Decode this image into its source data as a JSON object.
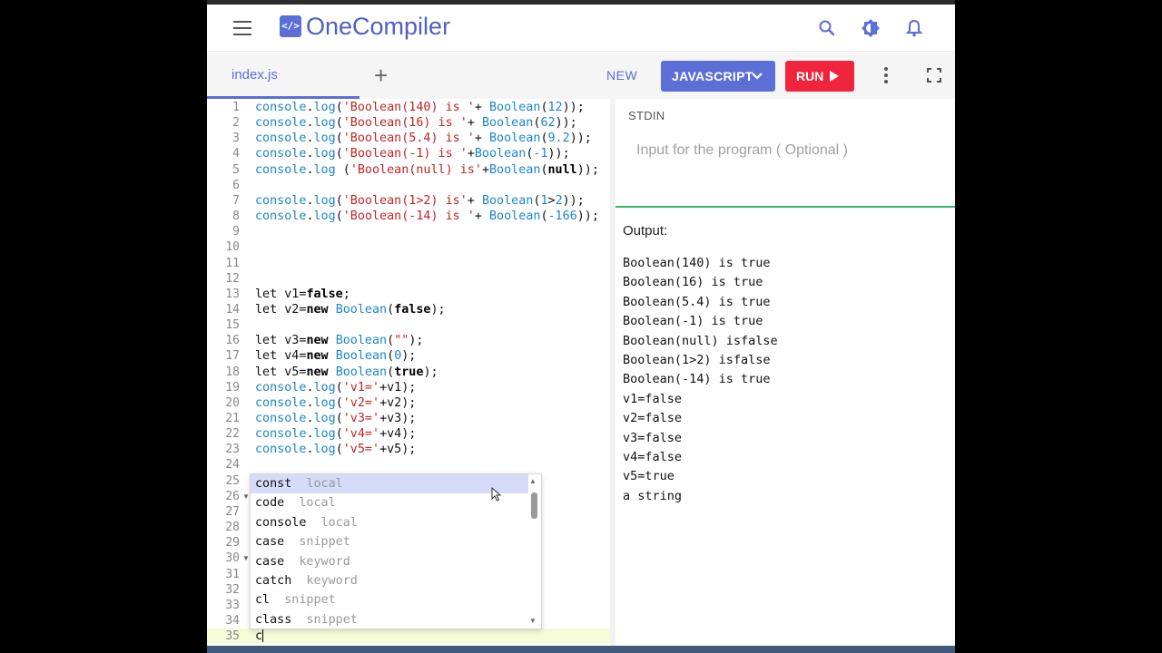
{
  "app": {
    "name": "OneCompiler",
    "logo_glyph": "</>",
    "accent_color": "#5b6fd6",
    "run_color": "#f0243c"
  },
  "header": {
    "icons": [
      "menu-icon",
      "search-icon",
      "theme-icon",
      "bell-icon"
    ]
  },
  "toolbar": {
    "file_tab": "index.js",
    "add_label": "+",
    "new_label": "NEW",
    "language_label": "JAVASCRIPT",
    "run_label": "RUN"
  },
  "editor": {
    "lines": [
      {
        "n": "1"
      },
      {
        "n": "2"
      },
      {
        "n": "3"
      },
      {
        "n": "4"
      },
      {
        "n": "5"
      },
      {
        "n": "6"
      },
      {
        "n": "7"
      },
      {
        "n": "8"
      },
      {
        "n": "9"
      },
      {
        "n": "10"
      },
      {
        "n": "11"
      },
      {
        "n": "12"
      },
      {
        "n": "13"
      },
      {
        "n": "14"
      },
      {
        "n": "15"
      },
      {
        "n": "16"
      },
      {
        "n": "17"
      },
      {
        "n": "18"
      },
      {
        "n": "19"
      },
      {
        "n": "20"
      },
      {
        "n": "21"
      },
      {
        "n": "22"
      },
      {
        "n": "23"
      },
      {
        "n": "24"
      },
      {
        "n": "25"
      },
      {
        "n": "26"
      },
      {
        "n": "27"
      },
      {
        "n": "28"
      },
      {
        "n": "29"
      },
      {
        "n": "30"
      },
      {
        "n": "31"
      },
      {
        "n": "32"
      },
      {
        "n": "33"
      },
      {
        "n": "34"
      },
      {
        "n": "35"
      }
    ],
    "code": [
      [
        [
          "f",
          "console"
        ],
        [
          "p",
          "."
        ],
        [
          "f",
          "log"
        ],
        [
          "p",
          "("
        ],
        [
          "s",
          "'Boolean(140) is '"
        ],
        [
          "p",
          "+ "
        ],
        [
          "b",
          "Boolean"
        ],
        [
          "p",
          "("
        ],
        [
          "n",
          "12"
        ],
        [
          "p",
          "));"
        ]
      ],
      [
        [
          "f",
          "console"
        ],
        [
          "p",
          "."
        ],
        [
          "f",
          "log"
        ],
        [
          "p",
          "("
        ],
        [
          "s",
          "'Boolean(16) is '"
        ],
        [
          "p",
          "+ "
        ],
        [
          "b",
          "Boolean"
        ],
        [
          "p",
          "("
        ],
        [
          "n",
          "62"
        ],
        [
          "p",
          "));"
        ]
      ],
      [
        [
          "f",
          "console"
        ],
        [
          "p",
          "."
        ],
        [
          "f",
          "log"
        ],
        [
          "p",
          "("
        ],
        [
          "s",
          "'Boolean(5.4) is '"
        ],
        [
          "p",
          "+ "
        ],
        [
          "b",
          "Boolean"
        ],
        [
          "p",
          "("
        ],
        [
          "n",
          "9.2"
        ],
        [
          "p",
          "));"
        ]
      ],
      [
        [
          "f",
          "console"
        ],
        [
          "p",
          "."
        ],
        [
          "f",
          "log"
        ],
        [
          "p",
          "("
        ],
        [
          "s",
          "'Boolean(-1) is '"
        ],
        [
          "p",
          "+"
        ],
        [
          "b",
          "Boolean"
        ],
        [
          "p",
          "("
        ],
        [
          "n",
          "-1"
        ],
        [
          "p",
          "));"
        ]
      ],
      [
        [
          "f",
          "console"
        ],
        [
          "p",
          "."
        ],
        [
          "f",
          "log"
        ],
        [
          "p",
          " ("
        ],
        [
          "s",
          "'Boolean(null) is'"
        ],
        [
          "p",
          "+"
        ],
        [
          "b",
          "Boolean"
        ],
        [
          "p",
          "("
        ],
        [
          "k",
          "null"
        ],
        [
          "p",
          "));"
        ]
      ],
      [],
      [
        [
          "f",
          "console"
        ],
        [
          "p",
          "."
        ],
        [
          "f",
          "log"
        ],
        [
          "p",
          "("
        ],
        [
          "s",
          "'Boolean(1>2) is'"
        ],
        [
          "p",
          "+ "
        ],
        [
          "b",
          "Boolean"
        ],
        [
          "p",
          "("
        ],
        [
          "n",
          "1"
        ],
        [
          "p",
          ">"
        ],
        [
          "n",
          "2"
        ],
        [
          "p",
          "));"
        ]
      ],
      [
        [
          "f",
          "console"
        ],
        [
          "p",
          "."
        ],
        [
          "f",
          "log"
        ],
        [
          "p",
          "("
        ],
        [
          "s",
          "'Boolean(-14) is '"
        ],
        [
          "p",
          "+ "
        ],
        [
          "b",
          "Boolean"
        ],
        [
          "p",
          "("
        ],
        [
          "n",
          "-166"
        ],
        [
          "p",
          "));"
        ]
      ],
      [],
      [],
      [],
      [],
      [
        [
          "p",
          "let v1="
        ],
        [
          "k",
          "false"
        ],
        [
          "p",
          ";"
        ]
      ],
      [
        [
          "p",
          "let v2="
        ],
        [
          "k",
          "new"
        ],
        [
          "p",
          " "
        ],
        [
          "b",
          "Boolean"
        ],
        [
          "p",
          "("
        ],
        [
          "k",
          "false"
        ],
        [
          "p",
          ");"
        ]
      ],
      [],
      [
        [
          "p",
          "let v3="
        ],
        [
          "k",
          "new"
        ],
        [
          "p",
          " "
        ],
        [
          "b",
          "Boolean"
        ],
        [
          "p",
          "("
        ],
        [
          "s",
          "\"\""
        ],
        [
          "p",
          ");"
        ]
      ],
      [
        [
          "p",
          "let v4="
        ],
        [
          "k",
          "new"
        ],
        [
          "p",
          " "
        ],
        [
          "b",
          "Boolean"
        ],
        [
          "p",
          "("
        ],
        [
          "n",
          "0"
        ],
        [
          "p",
          ");"
        ]
      ],
      [
        [
          "p",
          "let v5="
        ],
        [
          "k",
          "new"
        ],
        [
          "p",
          " "
        ],
        [
          "b",
          "Boolean"
        ],
        [
          "p",
          "("
        ],
        [
          "k",
          "true"
        ],
        [
          "p",
          ");"
        ]
      ],
      [
        [
          "f",
          "console"
        ],
        [
          "p",
          "."
        ],
        [
          "f",
          "log"
        ],
        [
          "p",
          "("
        ],
        [
          "s",
          "'v1='"
        ],
        [
          "p",
          "+v1);"
        ]
      ],
      [
        [
          "f",
          "console"
        ],
        [
          "p",
          "."
        ],
        [
          "f",
          "log"
        ],
        [
          "p",
          "("
        ],
        [
          "s",
          "'v2='"
        ],
        [
          "p",
          "+v2);"
        ]
      ],
      [
        [
          "f",
          "console"
        ],
        [
          "p",
          "."
        ],
        [
          "f",
          "log"
        ],
        [
          "p",
          "("
        ],
        [
          "s",
          "'v3='"
        ],
        [
          "p",
          "+v3);"
        ]
      ],
      [
        [
          "f",
          "console"
        ],
        [
          "p",
          "."
        ],
        [
          "f",
          "log"
        ],
        [
          "p",
          "("
        ],
        [
          "s",
          "'v4='"
        ],
        [
          "p",
          "+v4);"
        ]
      ],
      [
        [
          "f",
          "console"
        ],
        [
          "p",
          "."
        ],
        [
          "f",
          "log"
        ],
        [
          "p",
          "("
        ],
        [
          "s",
          "'v5='"
        ],
        [
          "p",
          "+v5);"
        ]
      ],
      [],
      [],
      [],
      [],
      [],
      [],
      [],
      [],
      [],
      [],
      [],
      [
        [
          "p",
          "c"
        ]
      ]
    ],
    "fold_lines": [
      "26",
      "30"
    ]
  },
  "autocomplete": {
    "items": [
      {
        "label": "const",
        "kind": "local"
      },
      {
        "label": "code",
        "kind": "local"
      },
      {
        "label": "console",
        "kind": "local"
      },
      {
        "label": "case",
        "kind": "snippet"
      },
      {
        "label": "case",
        "kind": "keyword"
      },
      {
        "label": "catch",
        "kind": "keyword"
      },
      {
        "label": "cl",
        "kind": "snippet"
      },
      {
        "label": "class",
        "kind": "snippet"
      }
    ]
  },
  "stdin": {
    "label": "STDIN",
    "placeholder": "Input for the program ( Optional )"
  },
  "output": {
    "label": "Output:",
    "lines": [
      "Boolean(140) is true",
      "Boolean(16) is true",
      "Boolean(5.4) is true",
      "Boolean(-1) is true",
      "Boolean(null) isfalse",
      "Boolean(1>2) isfalse",
      "Boolean(-14) is true",
      "v1=false",
      "v2=false",
      "v3=false",
      "v4=false",
      "v5=true",
      "a string"
    ]
  }
}
